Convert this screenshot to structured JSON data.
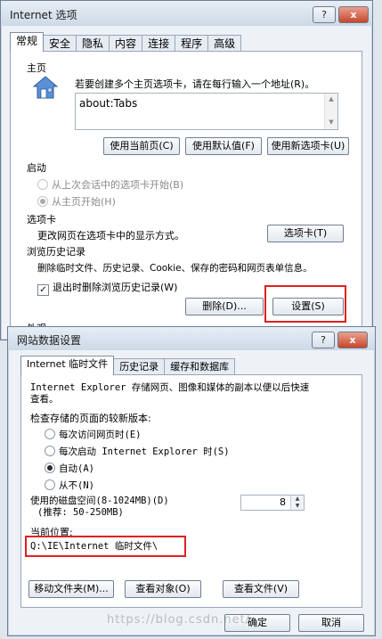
{
  "bg_dialog": {
    "title": "Internet 选项",
    "help_btn": "?",
    "close_btn": "x",
    "tabs": [
      "常规",
      "安全",
      "隐私",
      "内容",
      "连接",
      "程序",
      "高级"
    ],
    "homepage": {
      "section_label": "主页",
      "icon": "house-icon",
      "instruction": "若要创建多个主页选项卡，请在每行输入一个地址(R)。",
      "url_value": "about:Tabs",
      "btn_current": "使用当前页(C)",
      "btn_default": "使用默认值(F)",
      "btn_newtab": "使用新选项卡(U)"
    },
    "startup": {
      "section_label": "启动",
      "opt_last_session": "从上次会话中的选项卡开始(B)",
      "opt_homepage": "从主页开始(H)"
    },
    "tabsection": {
      "section_label": "选项卡",
      "text": "更改网页在选项卡中的显示方式。",
      "btn": "选项卡(T)"
    },
    "history": {
      "section_label": "浏览历史记录",
      "text": "删除临时文件、历史记录、Cookie、保存的密码和网页表单信息。",
      "checkbox_label": "退出时删除浏览历史记录(W)",
      "btn_delete": "删除(D)...",
      "btn_settings": "设置(S)"
    },
    "appearance_label": "外观"
  },
  "fg_dialog": {
    "title": "网站数据设置",
    "help_btn": "?",
    "close_btn": "x",
    "tabs": [
      "Internet 临时文件",
      "历史记录",
      "缓存和数据库"
    ],
    "desc": "Internet Explorer 存储网页、图像和媒体的副本以便以后快速查看。",
    "check_label": "检查存储的页面的较新版本:",
    "options": [
      "每次访问网页时(E)",
      "每次启动 Internet Explorer 时(S)",
      "自动(A)",
      "从不(N)"
    ],
    "disk_label": "使用的磁盘空间(8-1024MB)(D)",
    "disk_hint": "(推荐: 50-250MB)",
    "disk_value": "8",
    "location_label": "当前位置:",
    "location_value": "Q:\\IE\\Internet 临时文件\\",
    "btn_move": "移动文件夹(M)...",
    "btn_view_objects": "查看对象(O)",
    "btn_view_files": "查看文件(V)",
    "btn_ok": "确定",
    "btn_cancel": "取消"
  },
  "watermark": "https://blog.csdn.net/...",
  "colors": {
    "highlight_box": "#e02020",
    "close_button": "#c7472c"
  }
}
